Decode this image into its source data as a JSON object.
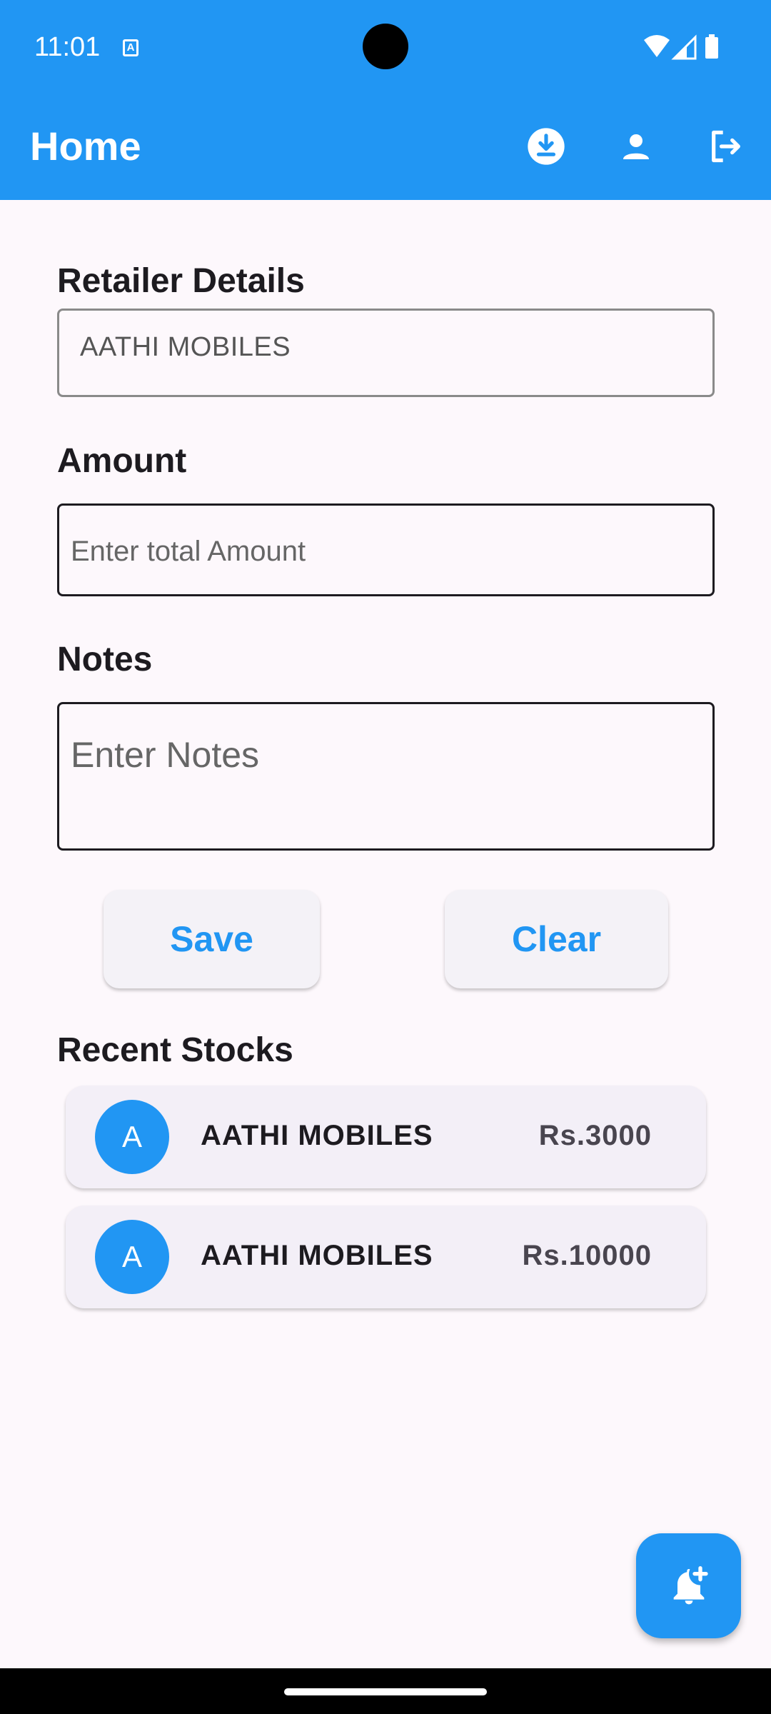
{
  "status_bar": {
    "time": "11:01",
    "notification_icon": "a-icon",
    "wifi_icon": "wifi-icon",
    "signal_icon": "signal-icon",
    "battery_icon": "battery-icon"
  },
  "app_bar": {
    "title": "Home",
    "actions": [
      "download-icon",
      "person-icon",
      "logout-icon"
    ],
    "color": "#2196f3"
  },
  "form": {
    "retailer_label": "Retailer Details",
    "retailer_value": "AATHI MOBILES",
    "amount_label": "Amount",
    "amount_placeholder": "Enter total Amount",
    "notes_label": "Notes",
    "notes_placeholder": "Enter Notes",
    "save_label": "Save",
    "clear_label": "Clear"
  },
  "recent_stocks": {
    "title": "Recent Stocks",
    "items": [
      {
        "initial": "A",
        "name": "AATHI MOBILES",
        "amount": "Rs.3000"
      },
      {
        "initial": "A",
        "name": "AATHI MOBILES",
        "amount": "Rs.10000"
      }
    ]
  },
  "fab": {
    "icon": "notification-add-icon"
  }
}
